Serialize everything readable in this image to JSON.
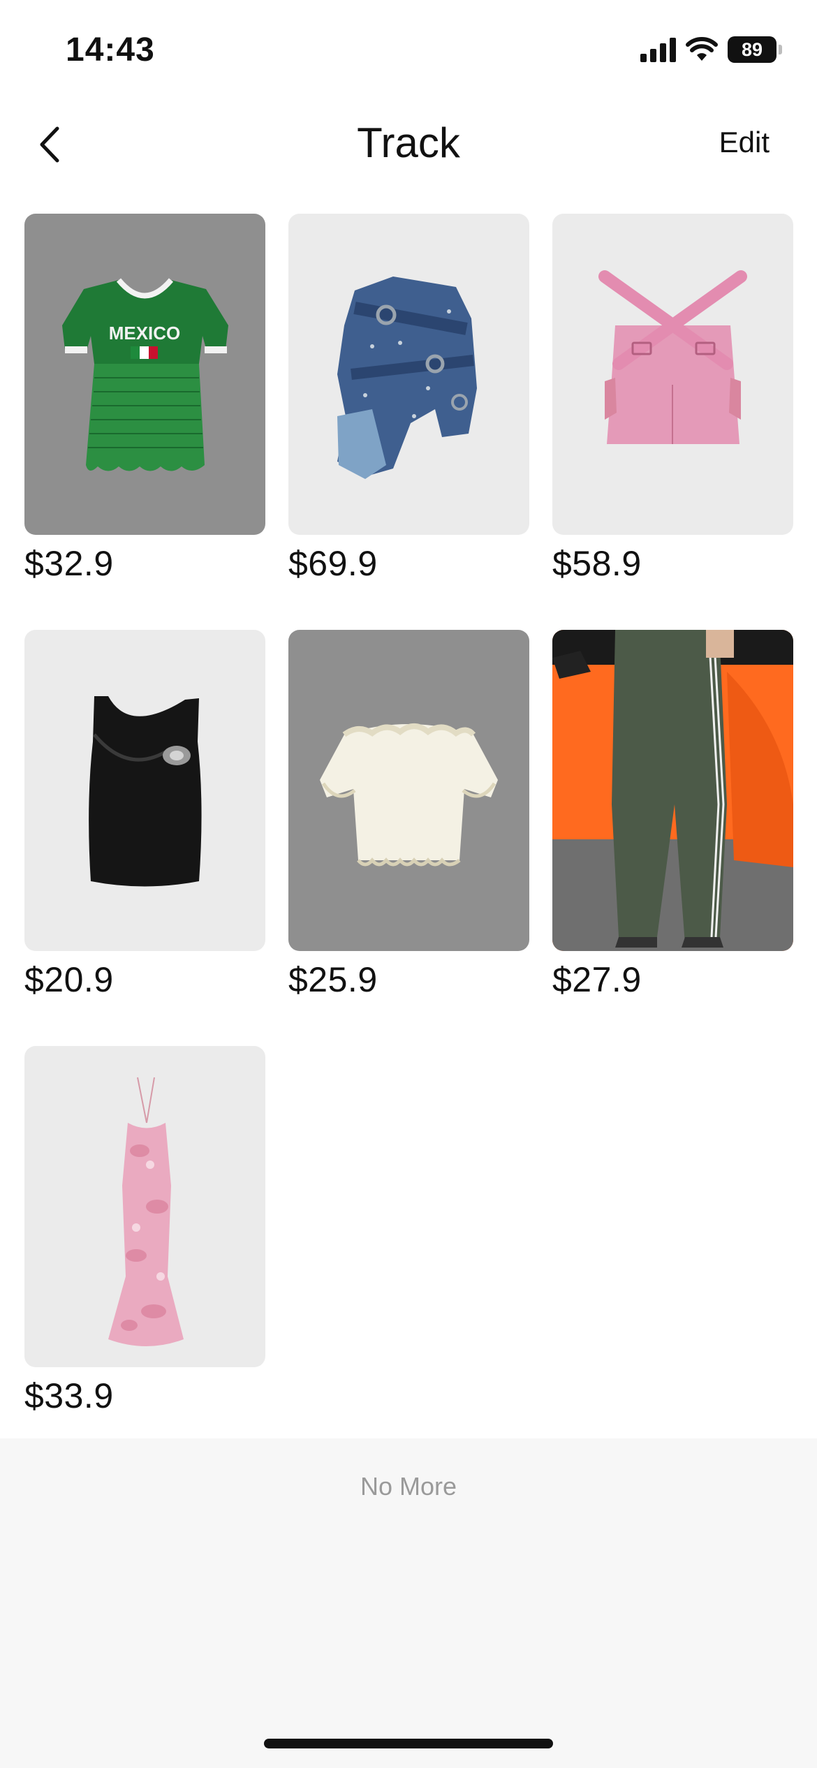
{
  "status_bar": {
    "time": "14:43",
    "battery": "89",
    "icons": [
      "cellular-signal-icon",
      "wifi-icon",
      "battery-icon"
    ]
  },
  "nav": {
    "title": "Track",
    "edit_label": "Edit",
    "back_icon": "chevron-left-icon"
  },
  "products": [
    {
      "price": "$32.9",
      "item": "green-mexico-jersey",
      "bg": "#8f8f8f"
    },
    {
      "price": "$69.9",
      "item": "denim-belted-jacket",
      "bg": "#ebebeb"
    },
    {
      "price": "$58.9",
      "item": "pink-cutout-top",
      "bg": "#ebebeb"
    },
    {
      "price": "$20.9",
      "item": "black-tank-top",
      "bg": "#ebebeb"
    },
    {
      "price": "$25.9",
      "item": "white-ruffle-top",
      "bg": "#8f8f8f"
    },
    {
      "price": "$27.9",
      "item": "green-track-pants",
      "bg": "#ff6a1f"
    },
    {
      "price": "$33.9",
      "item": "pink-halter-dress",
      "bg": "#ebebeb"
    }
  ],
  "footer": {
    "no_more": "No More"
  },
  "colors": {
    "background": "#ffffff",
    "footer_bg": "#f7f7f7",
    "muted_text": "#9a9a9a"
  }
}
